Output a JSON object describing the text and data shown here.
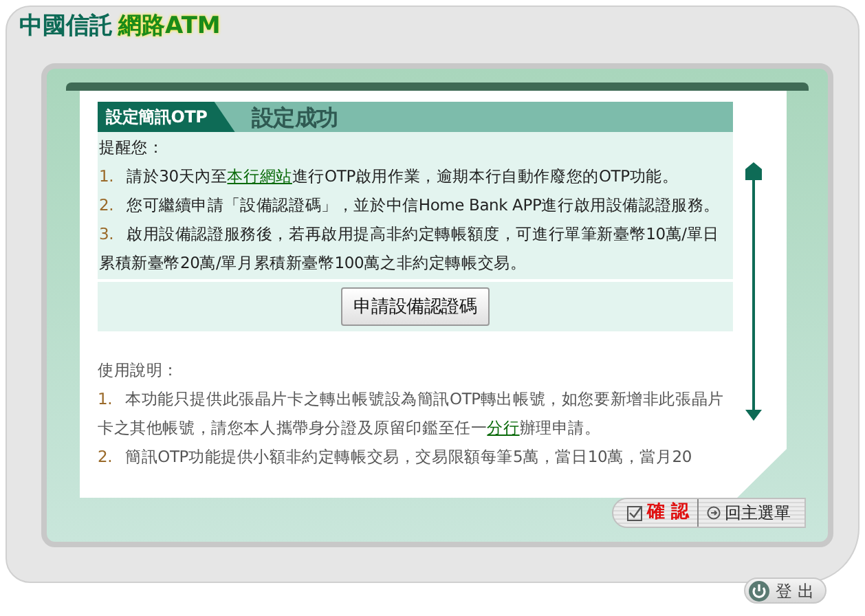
{
  "header": {
    "brand": "中國信託",
    "product": "網路ATM"
  },
  "panel": {
    "tab": "設定簡訊OTP",
    "title": "設定成功"
  },
  "reminder": {
    "heading": "提醒您：",
    "items": [
      {
        "number": "1.",
        "parts": [
          {
            "text": "請於30天內至"
          },
          {
            "text": "本行網站",
            "kind": "link"
          },
          {
            "text": "進行OTP啟用作業，逾期本行自動作廢您的OTP功能。"
          }
        ]
      },
      {
        "number": "2.",
        "parts": [
          {
            "text": "您可繼續申請「設備認證碼」，並於中信Home Bank APP進行啟用設備認證服務。"
          }
        ]
      },
      {
        "number": "3.",
        "parts": [
          {
            "text": "啟用設備認證服務後，若再啟用提高非約定轉帳額度，可進行單筆新臺幣10萬/單日累積新臺幣20萬/單月累積新臺幣100萬之非約定轉帳交易。"
          }
        ]
      }
    ]
  },
  "apply_button": "申請設備認證碼",
  "usage": {
    "heading": "使用說明：",
    "items": [
      {
        "number": "1.",
        "parts": [
          {
            "text": "本功能只提供此張晶片卡之轉出帳號設為簡訊OTP轉出帳號，如您要新增非此張晶片卡之其他帳號，請您本人攜帶身分證及原留印鑑至任一"
          },
          {
            "text": "分行",
            "kind": "link"
          },
          {
            "text": "辦理申請。"
          }
        ]
      },
      {
        "number": "2.",
        "parts": [
          {
            "text": "簡訊OTP功能提供小額非約定轉帳交易，交易限額每筆5萬，當日10萬，當月20"
          }
        ]
      }
    ]
  },
  "actions": [
    {
      "label": "確 認",
      "kind": "confirm"
    },
    {
      "label": "回主選單",
      "kind": "menu"
    }
  ],
  "logout": "登 出"
}
